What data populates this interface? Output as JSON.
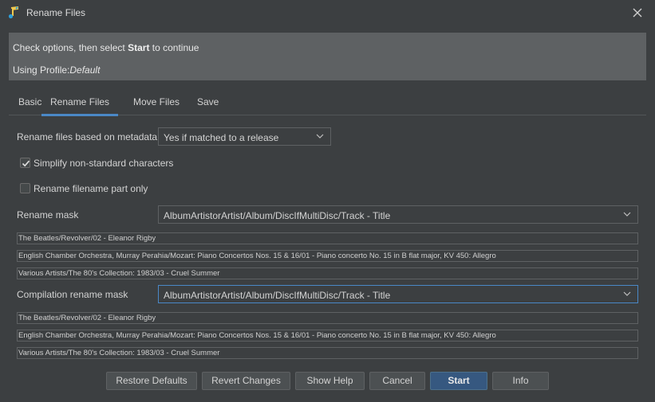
{
  "window": {
    "title": "Rename Files",
    "close_icon": "close-icon"
  },
  "info": {
    "line1_pre": "Check options, then select ",
    "line1_bold": "Start",
    "line1_post": " to continue",
    "line2_pre": "Using Profile:",
    "line2_italic": "Default"
  },
  "tabs": [
    {
      "label": "Basic",
      "active": false
    },
    {
      "label": "Rename Files",
      "active": true
    },
    {
      "label": "Move Files",
      "active": false
    },
    {
      "label": "Save",
      "active": false
    }
  ],
  "rename_based": {
    "label": "Rename files based on metadata",
    "value": "Yes if matched to a release"
  },
  "simplify": {
    "label": "Simplify non-standard characters",
    "checked": true
  },
  "filename_only": {
    "label": "Rename filename part only",
    "checked": false
  },
  "rename_mask": {
    "label": "Rename mask",
    "value": "AlbumArtistorArtist/Album/DiscIfMultiDisc/Track - Title",
    "previews": [
      "The Beatles/Revolver/02 - Eleanor Rigby",
      "English Chamber Orchestra, Murray Perahia/Mozart: Piano Concertos Nos. 15 & 16/01 - Piano concerto No. 15 in B flat major, KV 450: Allegro",
      "Various Artists/The 80's Collection: 1983/03 - Cruel Summer"
    ]
  },
  "compilation_mask": {
    "label": "Compilation rename mask",
    "value": "AlbumArtistorArtist/Album/DiscIfMultiDisc/Track - Title",
    "previews": [
      "The Beatles/Revolver/02 - Eleanor Rigby",
      "English Chamber Orchestra, Murray Perahia/Mozart: Piano Concertos Nos. 15 & 16/01 - Piano concerto No. 15 in B flat major, KV 450: Allegro",
      "Various Artists/The 80's Collection: 1983/03 - Cruel Summer"
    ]
  },
  "buttons": {
    "restore": "Restore Defaults",
    "revert": "Revert Changes",
    "help": "Show Help",
    "cancel": "Cancel",
    "start": "Start",
    "info": "Info"
  },
  "colors": {
    "accent": "#4a88c7",
    "primary_button": "#365880",
    "info_bg": "#5e6163"
  }
}
